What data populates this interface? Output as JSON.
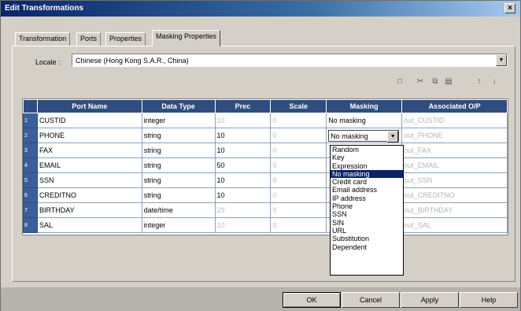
{
  "window": {
    "title": "Edit Transformations"
  },
  "tabs": [
    "Transformation",
    "Ports",
    "Properties",
    "Masking Properties"
  ],
  "locale": {
    "label": "Locale :",
    "value": "Chinese (Hong Kong S.A.R., China)"
  },
  "toolbar": {
    "icons": [
      "new-field-icon",
      "cut-icon",
      "copy-icon",
      "paste-icon",
      "move-up-icon",
      "move-down-icon"
    ],
    "glyphs": [
      "□",
      "✂",
      "⧉",
      "▤",
      "↑",
      "↓"
    ]
  },
  "grid": {
    "columns": [
      "Port Name",
      "Data Type",
      "Prec",
      "Scale",
      "Masking",
      "Associated O/P"
    ],
    "rows": [
      {
        "num": "1",
        "port": "CUSTID",
        "type": "integer",
        "prec": "10",
        "scale": "0",
        "masking": "No masking",
        "output": "out_CUSTID"
      },
      {
        "num": "2",
        "port": "PHONE",
        "type": "string",
        "prec": "10",
        "scale": "0",
        "masking": "No masking",
        "output": "out_PHONE"
      },
      {
        "num": "3",
        "port": "FAX",
        "type": "string",
        "prec": "10",
        "scale": "0",
        "masking": "",
        "output": "out_FAX"
      },
      {
        "num": "4",
        "port": "EMAIL",
        "type": "string",
        "prec": "50",
        "scale": "0",
        "masking": "",
        "output": "out_EMAIL"
      },
      {
        "num": "5",
        "port": "SSN",
        "type": "string",
        "prec": "10",
        "scale": "0",
        "masking": "",
        "output": "out_SSN"
      },
      {
        "num": "6",
        "port": "CREDITNO",
        "type": "string",
        "prec": "10",
        "scale": "0",
        "masking": "",
        "output": "out_CREDITNO"
      },
      {
        "num": "7",
        "port": "BIRTHDAY",
        "type": "date/time",
        "prec": "29",
        "scale": "9",
        "masking": "",
        "output": "out_BIRTHDAY"
      },
      {
        "num": "8",
        "port": "SAL",
        "type": "integer",
        "prec": "10",
        "scale": "0",
        "masking": "",
        "output": "out_SAL"
      }
    ]
  },
  "masking_options": [
    "Random",
    "Key",
    "Expression",
    "No masking",
    "Credit card",
    "Email address",
    "IP address",
    "Phone",
    "SSN",
    "SIN",
    "URL",
    "Substitution",
    "Dependent"
  ],
  "masking_selected": "No masking",
  "buttons": {
    "ok": "OK",
    "cancel": "Cancel",
    "apply": "Apply",
    "help": "Help"
  },
  "colors": {
    "grid_header": "#2f4d7e",
    "selection": "#0a246a",
    "title_bar": "#0a246a"
  }
}
